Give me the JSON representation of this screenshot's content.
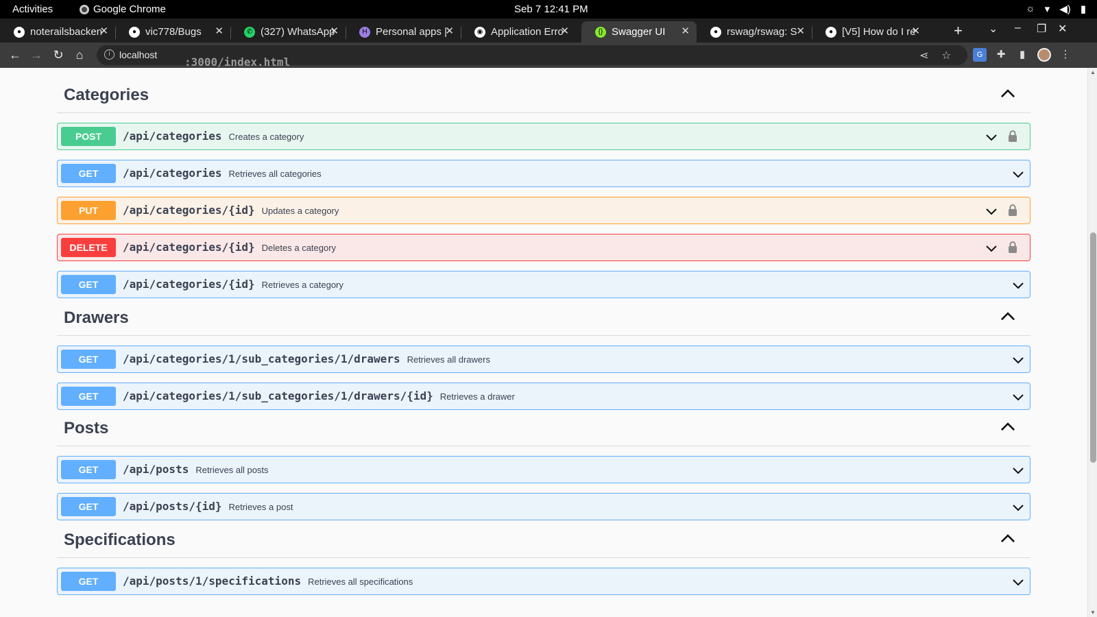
{
  "system_bar": {
    "activities": "Activities",
    "app_name": "Google Chrome",
    "clock": "Seb 7  12:41 PM"
  },
  "tabs": [
    {
      "title": "noterailsbacken",
      "icon": "github-icon",
      "active": false
    },
    {
      "title": "vic778/Bugs",
      "icon": "github-icon",
      "active": false
    },
    {
      "title": "(327) WhatsApp",
      "icon": "whatsapp-icon",
      "active": false
    },
    {
      "title": "Personal apps |",
      "icon": "heroku-icon",
      "active": false
    },
    {
      "title": "Application Erro",
      "icon": "globe-icon",
      "active": false
    },
    {
      "title": "Swagger UI",
      "icon": "swagger-icon",
      "active": true
    },
    {
      "title": "rswag/rswag: S",
      "icon": "github-icon",
      "active": false
    },
    {
      "title": "[V5] How do I re",
      "icon": "github-icon",
      "active": false
    }
  ],
  "omnibox": {
    "host": "localhost",
    "path": ":3000/index.html"
  },
  "sections": [
    {
      "title": "Categories",
      "operations": [
        {
          "method": "POST",
          "path": "/api/categories",
          "summary": "Creates a category",
          "locked": true
        },
        {
          "method": "GET",
          "path": "/api/categories",
          "summary": "Retrieves all categories",
          "locked": false
        },
        {
          "method": "PUT",
          "path": "/api/categories/{id}",
          "summary": "Updates a category",
          "locked": true
        },
        {
          "method": "DELETE",
          "path": "/api/categories/{id}",
          "summary": "Deletes a category",
          "locked": true
        },
        {
          "method": "GET",
          "path": "/api/categories/{id}",
          "summary": "Retrieves a category",
          "locked": false
        }
      ]
    },
    {
      "title": "Drawers",
      "operations": [
        {
          "method": "GET",
          "path": "/api/categories/1/sub_categories/1/drawers",
          "summary": "Retrieves all drawers",
          "locked": false
        },
        {
          "method": "GET",
          "path": "/api/categories/1/sub_categories/1/drawers/{id}",
          "summary": "Retrieves a drawer",
          "locked": false
        }
      ]
    },
    {
      "title": "Posts",
      "operations": [
        {
          "method": "GET",
          "path": "/api/posts",
          "summary": "Retrieves all posts",
          "locked": false
        },
        {
          "method": "GET",
          "path": "/api/posts/{id}",
          "summary": "Retrieves a post",
          "locked": false
        }
      ]
    },
    {
      "title": "Specifications",
      "operations": [
        {
          "method": "GET",
          "path": "/api/posts/1/specifications",
          "summary": "Retrieves all specifications",
          "locked": false
        }
      ]
    }
  ],
  "colors": {
    "post": "#49cc90",
    "get": "#61affe",
    "put": "#fca130",
    "delete": "#f93e3e"
  }
}
